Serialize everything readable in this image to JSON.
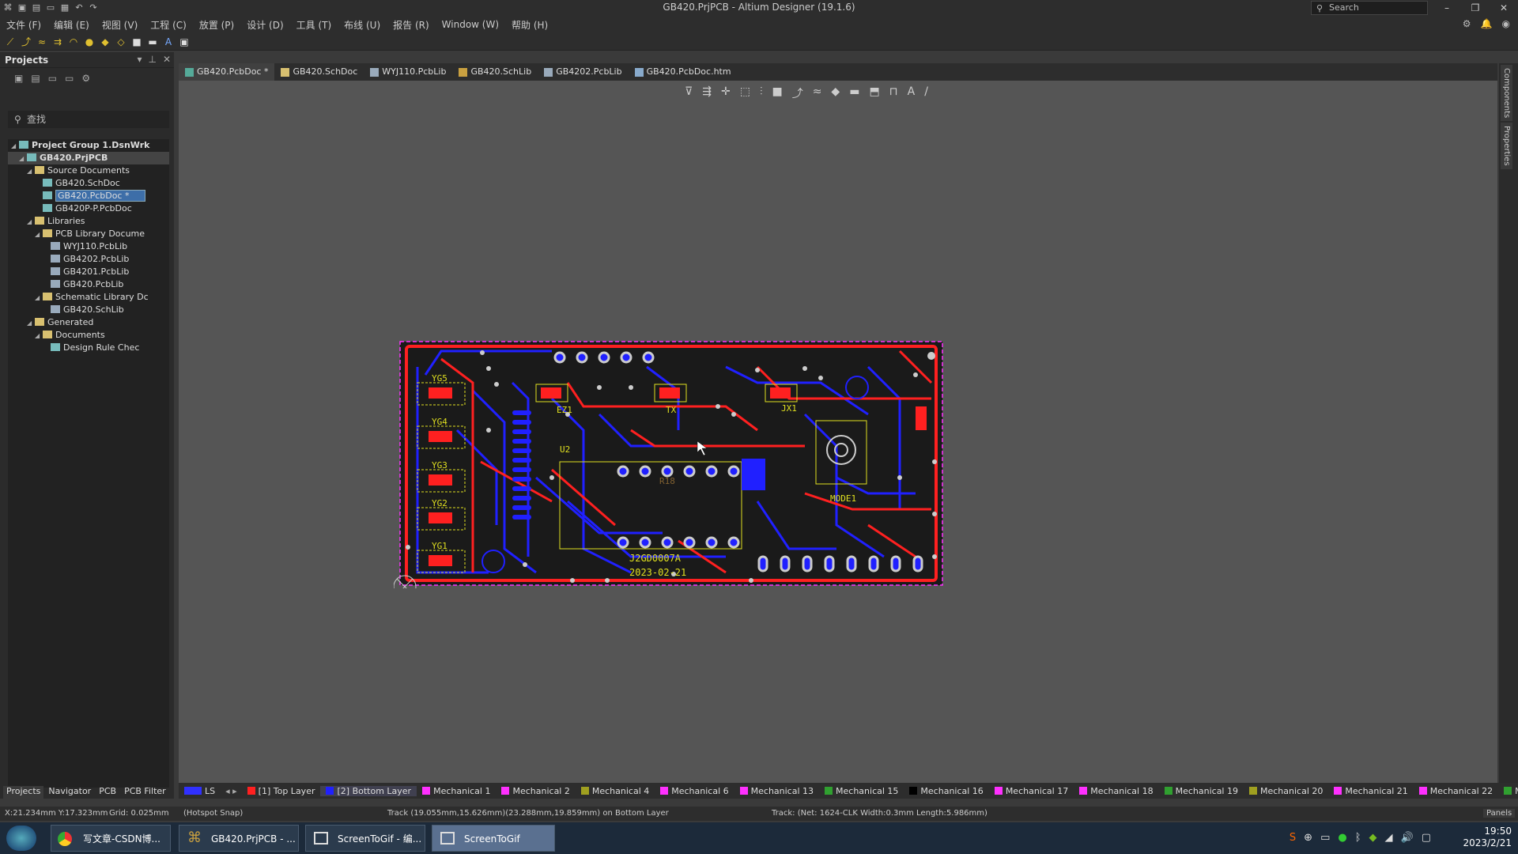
{
  "window": {
    "title": "GB420.PrjPCB - Altium Designer (19.1.6)",
    "search_label": "Search"
  },
  "menu": [
    "文件 (F)",
    "编辑 (E)",
    "视图 (V)",
    "工程 (C)",
    "放置 (P)",
    "设计 (D)",
    "工具 (T)",
    "布线 (U)",
    "报告 (R)",
    "Window (W)",
    "帮助 (H)"
  ],
  "projects_panel": {
    "title": "Projects",
    "search_placeholder": "查找",
    "tree": [
      {
        "label": "Project Group 1.DsnWrk",
        "level": 0,
        "icon": "workspace-icon",
        "bold": true
      },
      {
        "label": "GB420.PrjPCB",
        "level": 1,
        "icon": "project-icon",
        "bold": true,
        "highlight": true
      },
      {
        "label": "Source Documents",
        "level": 2,
        "icon": "folder-icon"
      },
      {
        "label": "GB420.SchDoc",
        "level": 3,
        "icon": "schematic-icon"
      },
      {
        "label": "GB420.PcbDoc *",
        "level": 3,
        "icon": "pcb-icon",
        "selected": true
      },
      {
        "label": "GB420P-P.PcbDoc",
        "level": 3,
        "icon": "pcb-icon"
      },
      {
        "label": "Libraries",
        "level": 2,
        "icon": "folder-icon"
      },
      {
        "label": "PCB Library Docume",
        "level": 3,
        "icon": "folder-icon"
      },
      {
        "label": "WYJ110.PcbLib",
        "level": 4,
        "icon": "pcblib-icon"
      },
      {
        "label": "GB4202.PcbLib",
        "level": 4,
        "icon": "pcblib-icon"
      },
      {
        "label": "GB4201.PcbLib",
        "level": 4,
        "icon": "pcblib-icon"
      },
      {
        "label": "GB420.PcbLib",
        "level": 4,
        "icon": "pcblib-icon"
      },
      {
        "label": "Schematic Library Dc",
        "level": 3,
        "icon": "folder-icon"
      },
      {
        "label": "GB420.SchLib",
        "level": 4,
        "icon": "schlib-icon"
      },
      {
        "label": "Generated",
        "level": 2,
        "icon": "folder-icon"
      },
      {
        "label": "Documents",
        "level": 3,
        "icon": "folder-icon"
      },
      {
        "label": "Design Rule Chec",
        "level": 4,
        "icon": "report-icon"
      }
    ],
    "bottom_tabs": [
      "Projects",
      "Navigator",
      "PCB",
      "PCB Filter"
    ]
  },
  "doc_tabs": [
    "GB420.PcbDoc *",
    "GB420.SchDoc",
    "WYJ110.PcbLib",
    "GB420.SchLib",
    "GB4202.PcbLib",
    "GB420.PcbDoc.htm"
  ],
  "right_panels": [
    "Components",
    "Properties"
  ],
  "pcb_labels": {
    "yg5": "YG5",
    "yg4": "YG4",
    "yg3": "YG3",
    "yg2": "YG2",
    "yg1": "YG1",
    "u2": "U2",
    "mode1": "MODE1",
    "r18": "R18",
    "code": "J2GD0007A",
    "date": "2023-02-21",
    "jx1": "JX1",
    "ez1": "EZ1",
    "tx": "TX"
  },
  "layers": [
    {
      "name": "LS",
      "color": "#3030ff",
      "ls": true
    },
    {
      "name": "[1] Top Layer",
      "color": "#ff2020"
    },
    {
      "name": "[2] Bottom Layer",
      "color": "#2020ff",
      "active": true
    },
    {
      "name": "Mechanical 1",
      "color": "#ff30ff"
    },
    {
      "name": "Mechanical 2",
      "color": "#ff30ff"
    },
    {
      "name": "Mechanical 4",
      "color": "#a0a020"
    },
    {
      "name": "Mechanical 6",
      "color": "#ff30ff"
    },
    {
      "name": "Mechanical 13",
      "color": "#ff30ff"
    },
    {
      "name": "Mechanical 15",
      "color": "#30a030"
    },
    {
      "name": "Mechanical 16",
      "color": "#000000"
    },
    {
      "name": "Mechanical 17",
      "color": "#ff30ff"
    },
    {
      "name": "Mechanical 18",
      "color": "#ff30ff"
    },
    {
      "name": "Mechanical 19",
      "color": "#30a030"
    },
    {
      "name": "Mechanical 20",
      "color": "#a0a020"
    },
    {
      "name": "Mechanical 21",
      "color": "#ff30ff"
    },
    {
      "name": "Mechanical 22",
      "color": "#ff30ff"
    },
    {
      "name": "Mec",
      "color": "#30a030"
    }
  ],
  "status": {
    "coords": "X:21.234mm Y:17.323mm",
    "grid": "Grid: 0.025mm",
    "snap": "(Hotspot Snap)",
    "track": "Track (19.055mm,15.626mm)(23.288mm,19.859mm) on Bottom Layer",
    "net": "Track: (Net: 1624-CLK Width:0.3mm Length:5.986mm)",
    "panels_label": "Panels"
  },
  "taskbar": {
    "apps": [
      "写文章-CSDN博...",
      "GB420.PrjPCB - ...",
      "ScreenToGif - 编...",
      "ScreenToGif"
    ],
    "time": "19:50",
    "date": "2023/2/21"
  }
}
